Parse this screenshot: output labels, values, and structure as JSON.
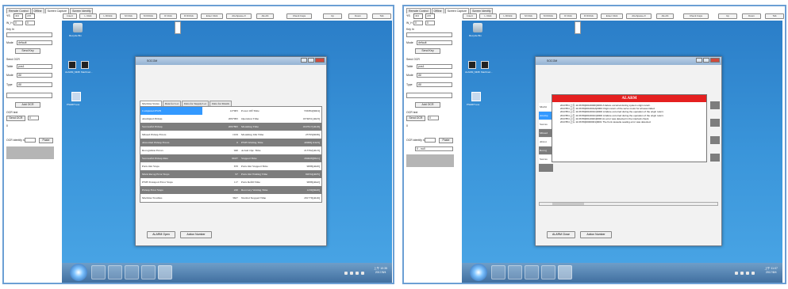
{
  "left": {
    "tabs": [
      "Remote Control",
      "Offline",
      "Screen Capture",
      "Screen Identify"
    ],
    "toolbar_inputs": [
      {
        "label": "YS",
        "value": "404"
      },
      {
        "label": "",
        "value": "215"
      }
    ],
    "toolbar": [
      "Insert",
      "L Click",
      "L DClick",
      "M Click",
      "M DClick",
      "R Click",
      "R DClick",
      "Enter Click",
      "Alt+Space+X",
      "Alt+F4",
      "Check Caps",
      "Up",
      "Down",
      "Tab"
    ],
    "sidebar": {
      "w_h_label": "W_H",
      "w_value": "0",
      "h_value": "0",
      "key_in_label": "Key In",
      "mode_label": "Mode",
      "mode_value": "default",
      "send_key": "Send Key",
      "send_ocr_label": "Send OCR",
      "table_label": "Table",
      "table_value": "pos1",
      "mode2_label": "Mode",
      "mode2_value": "All",
      "type_label": "Type",
      "type_value": "All",
      "add_ocr": "Add OCR",
      "ocr_text_label": "OCR text",
      "send_ocr_btn": "Send OCR",
      "send_ocr_value": "0",
      "zero": "0",
      "ocr_identify_label": "OCR identify no.",
      "paste": "Paste"
    },
    "desktop_icons": [
      {
        "label": "Recycle Bin"
      },
      {
        "label": "ALARM_MDB"
      },
      {
        "label": "Machinel..."
      },
      {
        "label": "PSHRIT.exe"
      }
    ],
    "window": {
      "title": "SOCOM",
      "tabs": [
        "Machine Status",
        "Data for Lot",
        "Data for Supply Lot",
        "Data for Month"
      ],
      "rows": [
        {
          "c1": "Completed PWB",
          "c2": "127905",
          "c3": "Power Off Time",
          "c4": "556384[6h04]",
          "style": "sel"
        },
        {
          "c1": "Attempted Pickup",
          "c2": "2097995",
          "c3": "Operation Time",
          "c4": "1074651[4h23]",
          "style": "light"
        },
        {
          "c1": "Successful Pickup",
          "c2": "2097895",
          "c3": "Mounting Time",
          "c4": "1047917[4h18]",
          "style": "dark"
        },
        {
          "c1": "Missed Pickup Errors",
          "c2": "1919",
          "c3": "Mounting Idle Time",
          "c4": "23793[6h36]",
          "style": "light"
        },
        {
          "c1": "Abnormal Pickup Errors",
          "c2": "0",
          "c3": "PWB Waiting Time",
          "c4": "40968[11h23]",
          "style": "dark"
        },
        {
          "c1": "Recognition Errors",
          "c2": "940",
          "c3": "Actual Opr. Time",
          "c4": "213762[4h13]",
          "style": "light"
        },
        {
          "c1": "Successful Pickup Rate",
          "c2": "99.87",
          "c3": "Stopped Time",
          "c4": "294628[8h11]",
          "style": "dark"
        },
        {
          "c1": "Parts Out Stops",
          "c2": "670",
          "c3": "Parts Out Stopped Time",
          "c4": "9088[4h20]",
          "style": "light"
        },
        {
          "c1": "Mark Recog Error Stops",
          "c2": "97",
          "c3": "Parts Out Waiting Time",
          "c4": "92034[4h35]",
          "style": "dark"
        },
        {
          "c1": "PWB Transport Error Stops",
          "c2": "117",
          "c3": "Parts Refill Time",
          "c4": "9088[4h42]",
          "style": "light"
        },
        {
          "c1": "Pickup Error Stops",
          "c2": "220",
          "c3": "Recovery Waiting Time",
          "c4": "1230[6h20]",
          "style": "dark"
        },
        {
          "c1": "Machine Troubles",
          "c2": "3627",
          "c3": "Normal Stopped Time",
          "c4": "291779[4h16]",
          "style": "light"
        }
      ],
      "alarm_open": "ALARM Open",
      "action_number": "Action Number"
    },
    "clock": {
      "time": "上午 10:35",
      "date": "2017/8/4"
    }
  },
  "right": {
    "tabs": [
      "Remote Control",
      "Offline",
      "Screen Capture",
      "Screen Identify"
    ],
    "toolbar_inputs": [
      {
        "label": "YS",
        "value": "404"
      },
      {
        "label": "",
        "value": "215"
      }
    ],
    "toolbar": [
      "Insert",
      "L Click",
      "L DClick",
      "M Click",
      "M DClick",
      "R Click",
      "R DClick",
      "Enter Click",
      "Alt+Space+X",
      "Alt+F4",
      "Check Caps",
      "Up",
      "Down",
      "Tab"
    ],
    "sidebar": {
      "w_h_label": "W_H",
      "w_value": "0",
      "h_value": "0",
      "key_in_label": "Key In",
      "mode_label": "Mode",
      "mode_value": "default",
      "send_key": "Send Key",
      "send_ocr_label": "Send OCR",
      "table_label": "Table",
      "table_value": "pos1",
      "mode2_label": "Mode",
      "mode2_value": "All",
      "type_label": "Type",
      "type_value": "All",
      "add_ocr": "Add OCR",
      "ocr_text_label": "OCR text",
      "send_ocr_btn": "Send OCR",
      "send_ocr_value": "0",
      "zero": "0",
      "ocr_identify_label": "OCR identify no.",
      "paste": "Paste",
      "select_value": "0 - null"
    },
    "desktop_icons": [
      {
        "label": "Recycle Bin"
      },
      {
        "label": "ALARM_MDB"
      },
      {
        "label": "Machinel..."
      },
      {
        "label": "PSHRIT.exe"
      }
    ],
    "window": {
      "title": "SOCOM",
      "alarm_title": "ALARM",
      "alarm_lines": [
        "2017/8/4 上午 11:06:56[0010000F]0000 A failure occurred during system origin return.",
        "2017/8/4 上午 11:06:56[0010001A]0000 Origin return of the servo motor for all axes failed.",
        "2017/8/4 上午 11:06:56[0010001C]0000 A failure occurred during the operation of the origin return.",
        "2017/8/4 上午 11:06:56[0010001C]0000 A failure occurred during the operation of the origin return.",
        "2017/8/4 上午 11:06:56[00110021]0000 An error was detected in the interlock check.",
        "2017/8/4 上午 11:06:56[00000001]0001 The front cassette seating error was detected."
      ],
      "left_labels": [
        "Machi",
        "Attemp",
        "Succes",
        "Missed",
        "Abnor",
        "Recog",
        "Succes"
      ],
      "alarm_close": "ALARM Close",
      "action_number": "Action Number"
    },
    "clock": {
      "time": "上午 11:07",
      "date": "2017/8/4"
    }
  }
}
